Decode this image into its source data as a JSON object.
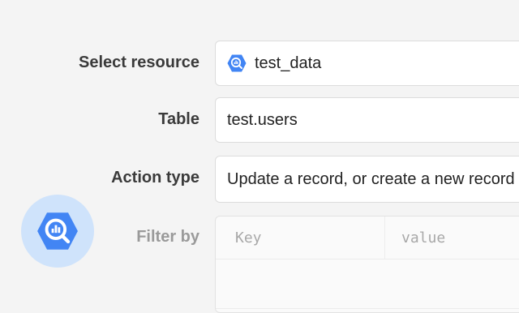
{
  "form": {
    "resource": {
      "label": "Select resource",
      "value": "test_data",
      "icon": "bigquery-icon"
    },
    "table": {
      "label": "Table",
      "value": "test.users"
    },
    "action_type": {
      "label": "Action type",
      "value": "Update a record, or create a new record"
    },
    "filter_by": {
      "label": "Filter by",
      "key_placeholder": "Key",
      "value_placeholder": "value"
    }
  },
  "badge": {
    "icon": "bigquery-icon"
  },
  "colors": {
    "accent": "#4285f4",
    "badge_bg": "#cfe3fb",
    "page_bg": "#f4f4f4"
  }
}
